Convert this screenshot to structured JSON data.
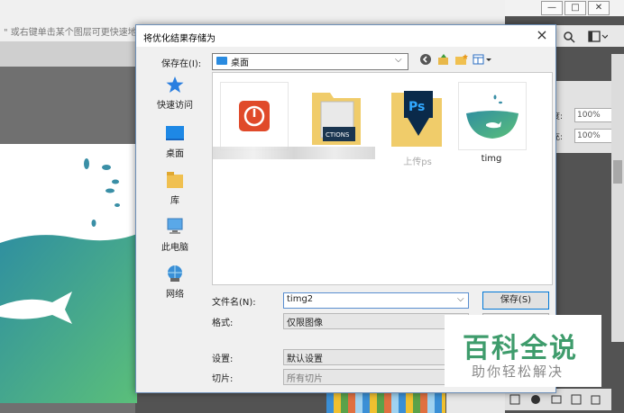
{
  "photoshop": {
    "hint_text": "\" 或右键单击某个图层可更快速地",
    "window_controls": [
      "—",
      "□",
      "✕"
    ],
    "opacity_label": "度:",
    "opacity_value": "100%",
    "fill_label": "充:",
    "fill_value": "100%"
  },
  "dialog": {
    "title": "将优化结果存储为",
    "close_label": "×",
    "save_in_label": "保存在(I):",
    "save_in_value": "桌面",
    "toolbar": [
      "back-icon",
      "up-folder-icon",
      "new-folder-icon",
      "view-menu-icon"
    ],
    "places": [
      {
        "label": "快速访问",
        "icon": "star-icon"
      },
      {
        "label": "桌面",
        "icon": "desktop-icon"
      },
      {
        "label": "库",
        "icon": "library-icon"
      },
      {
        "label": "此电脑",
        "icon": "computer-icon"
      },
      {
        "label": "网络",
        "icon": "network-icon"
      }
    ],
    "files": [
      {
        "name": "",
        "icon": "app-shortcut-icon"
      },
      {
        "name": "",
        "icon": "actions-folder-icon"
      },
      {
        "name": "上传ps",
        "icon": "ps-folder-icon"
      },
      {
        "name": "timg",
        "icon": "image-thumbnail"
      }
    ],
    "filename_label": "文件名(N):",
    "filename_value": "timg2",
    "format_label": "格式:",
    "format_value": "仅限图像",
    "settings_label": "设置:",
    "settings_value": "默认设置",
    "slices_label": "切片:",
    "slices_value": "所有切片",
    "save_label": "保存(S)"
  },
  "watermark": {
    "title": "百科全说",
    "subtitle": "助你轻松解决"
  },
  "colors": {
    "dialog_border": "#6c8fb8",
    "accent_blue": "#0078d7",
    "watermark_green": "#3f9c6c"
  }
}
